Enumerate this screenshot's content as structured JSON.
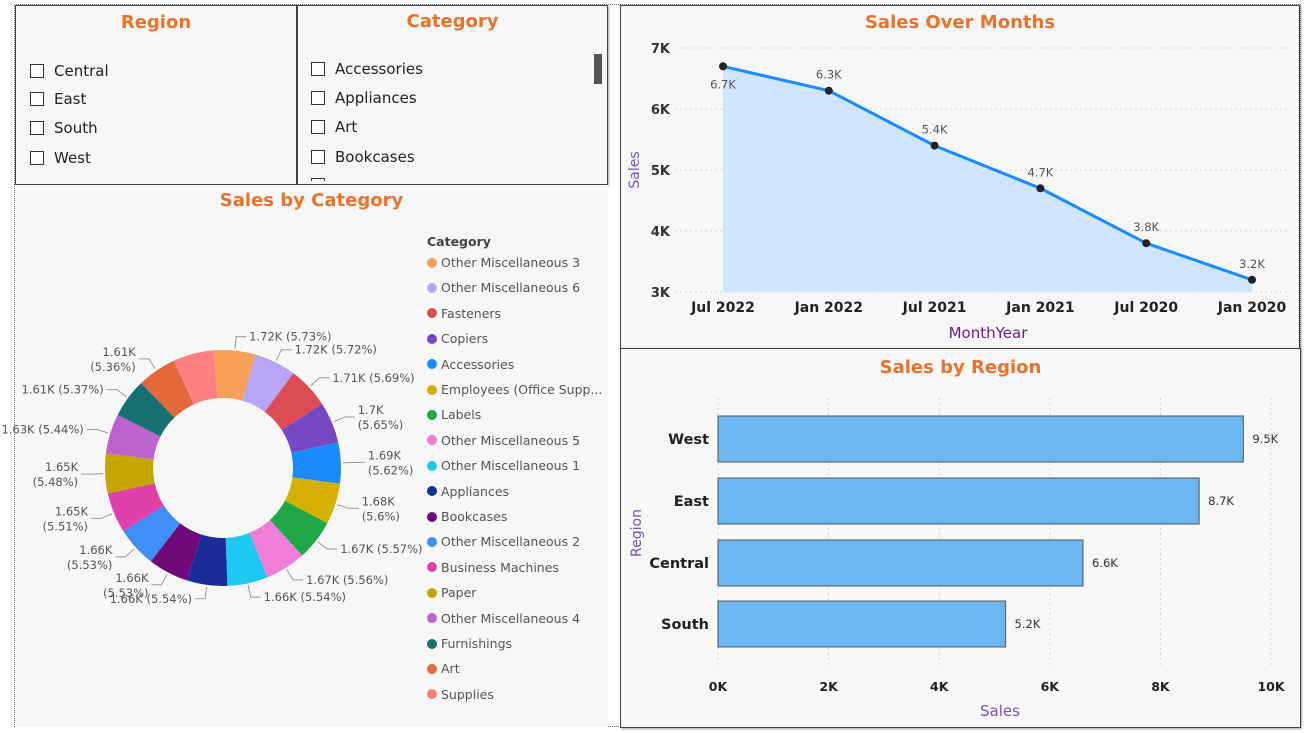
{
  "region_slicer": {
    "title": "Region",
    "items": [
      "Central",
      "East",
      "South",
      "West"
    ]
  },
  "category_slicer": {
    "title": "Category",
    "items": [
      "Accessories",
      "Appliances",
      "Art",
      "Bookcases"
    ]
  },
  "donut": {
    "title": "Sales by Category",
    "legend_title": "Category",
    "legend": [
      {
        "label": "Other Miscellaneous 3",
        "color": "#f7a05a"
      },
      {
        "label": "Other Miscellaneous 6",
        "color": "#b7a5f7"
      },
      {
        "label": "Fasteners",
        "color": "#dd4b53"
      },
      {
        "label": "Copiers",
        "color": "#7648c4"
      },
      {
        "label": "Accessories",
        "color": "#1a8cff"
      },
      {
        "label": "Employees (Office Supp...",
        "color": "#d6b000"
      },
      {
        "label": "Labels",
        "color": "#1fa845"
      },
      {
        "label": "Other Miscellaneous 5",
        "color": "#f07ed8"
      },
      {
        "label": "Other Miscellaneous 1",
        "color": "#1ec8f0"
      },
      {
        "label": "Appliances",
        "color": "#1a2c9a"
      },
      {
        "label": "Bookcases",
        "color": "#6e0a7a"
      },
      {
        "label": "Other Miscellaneous 2",
        "color": "#3e8ef5"
      },
      {
        "label": "Business Machines",
        "color": "#e040a8"
      },
      {
        "label": "Paper",
        "color": "#c3a400"
      },
      {
        "label": "Other Miscellaneous 4",
        "color": "#c061d0"
      },
      {
        "label": "Furnishings",
        "color": "#177172"
      },
      {
        "label": "Art",
        "color": "#e5683a"
      },
      {
        "label": "Supplies",
        "color": "#ff8080"
      }
    ]
  },
  "chart_data": [
    {
      "type": "area",
      "title": "Sales Over Months",
      "xlabel": "MonthYear",
      "ylabel": "Sales",
      "categories": [
        "Jul 2022",
        "Jan 2022",
        "Jul 2021",
        "Jan 2021",
        "Jul 2020",
        "Jan 2020"
      ],
      "values": [
        6700,
        6300,
        5400,
        4700,
        3800,
        3200
      ],
      "data_labels": [
        "6.7K",
        "6.3K",
        "5.4K",
        "4.7K",
        "3.8K",
        "3.2K"
      ],
      "yticks": [
        "7K",
        "6K",
        "5K",
        "4K",
        "3K"
      ],
      "ylim": [
        3000,
        7000
      ],
      "line_color": "#1a8cff",
      "fill_color": "#cfe5fb"
    },
    {
      "type": "bar",
      "orientation": "horizontal",
      "title": "Sales by Region",
      "xlabel": "Sales",
      "ylabel": "Region",
      "categories": [
        "West",
        "East",
        "Central",
        "South"
      ],
      "values": [
        9500,
        8700,
        6600,
        5200
      ],
      "data_labels": [
        "9.5K",
        "8.7K",
        "6.6K",
        "5.2K"
      ],
      "xticks": [
        "0K",
        "2K",
        "4K",
        "6K",
        "8K",
        "10K"
      ],
      "xlim": [
        0,
        10000
      ],
      "bar_color": "#6bb7f2"
    },
    {
      "type": "pie",
      "variant": "donut",
      "title": "Sales by Category",
      "categories": [
        "Other Miscellaneous 3",
        "Other Miscellaneous 6",
        "Fasteners",
        "Copiers",
        "Accessories",
        "Employees (Office Supp...",
        "Labels",
        "Other Miscellaneous 5",
        "Other Miscellaneous 1",
        "Appliances",
        "Bookcases",
        "Other Miscellaneous 2",
        "Business Machines",
        "Paper",
        "Other Miscellaneous 4",
        "Furnishings",
        "Art",
        "Supplies"
      ],
      "values": [
        5.73,
        5.72,
        5.69,
        5.65,
        5.62,
        5.6,
        5.57,
        5.56,
        5.54,
        5.54,
        5.53,
        5.53,
        5.51,
        5.48,
        5.44,
        5.37,
        5.36,
        5.56
      ],
      "labels": [
        {
          "text1": "1.72K (5.73%)",
          "text2": ""
        },
        {
          "text1": "1.72K (5.72%)",
          "text2": ""
        },
        {
          "text1": "1.71K (5.69%)",
          "text2": ""
        },
        {
          "text1": "1.7K",
          "text2": "(5.65%)"
        },
        {
          "text1": "1.69K",
          "text2": "(5.62%)"
        },
        {
          "text1": "1.68K",
          "text2": "(5.6%)"
        },
        {
          "text1": "1.67K (5.57%)",
          "text2": ""
        },
        {
          "text1": "1.67K (5.56%)",
          "text2": ""
        },
        {
          "text1": "1.66K (5.54%)",
          "text2": ""
        },
        {
          "text1": "1.66K (5.54%)",
          "text2": ""
        },
        {
          "text1": "1.66K",
          "text2": "(5.53%)"
        },
        {
          "text1": "1.66K",
          "text2": "(5.53%)"
        },
        {
          "text1": "1.65K",
          "text2": "(5.51%)"
        },
        {
          "text1": "1.65K",
          "text2": "(5.48%)"
        },
        {
          "text1": "1.63K (5.44%)",
          "text2": ""
        },
        {
          "text1": "1.61K (5.37%)",
          "text2": ""
        },
        {
          "text1": "1.61K",
          "text2": "(5.36%)"
        },
        {
          "text1": "",
          "text2": ""
        }
      ]
    }
  ]
}
